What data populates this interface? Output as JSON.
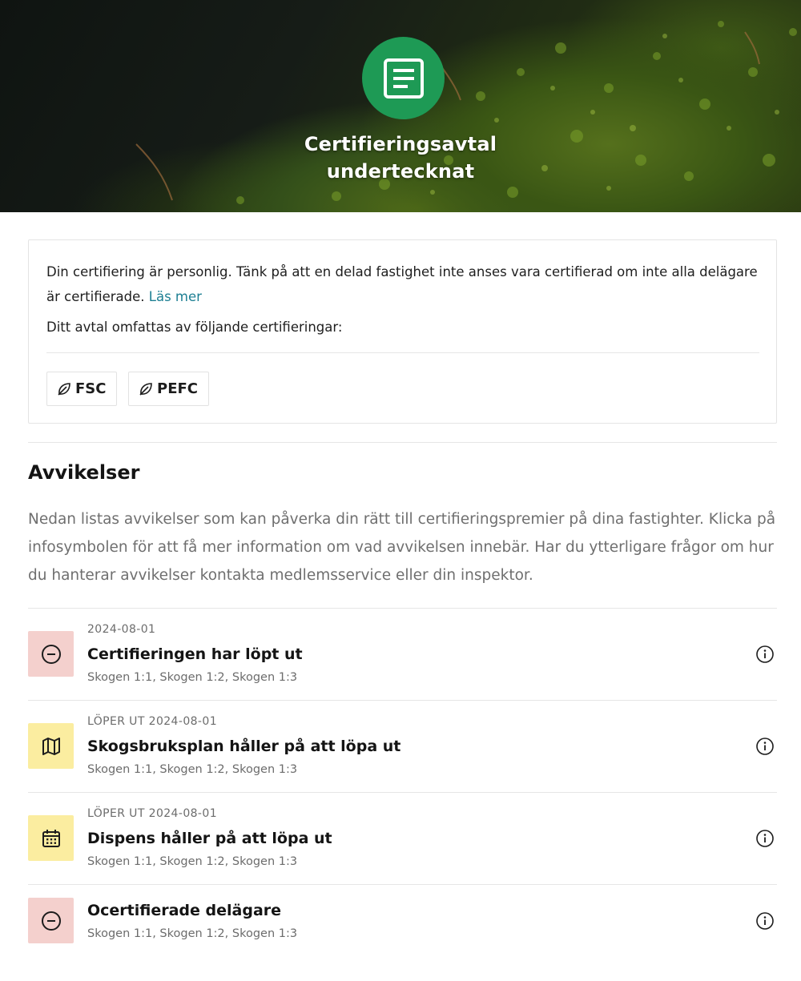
{
  "hero": {
    "title_line1": "Certifieringsavtal",
    "title_line2": "undertecknat",
    "icon": "document-icon",
    "icon_color": "#1e9a55"
  },
  "info": {
    "text": "Din certifiering är personlig. Tänk på att en delad fastighet inte anses vara certifierad om inte alla delägare är certifierade.",
    "link_label": "Läs mer",
    "link_color": "#1d7f93",
    "covered_label": "Ditt avtal omfattas av följande certifieringar:",
    "certifications": [
      {
        "label": "FSC",
        "icon": "leaf-icon"
      },
      {
        "label": "PEFC",
        "icon": "leaf-icon"
      }
    ]
  },
  "deviations": {
    "title": "Avvikelser",
    "description": "Nedan listas avvikelser som kan påverka din rätt till certifieringspremier på dina fastighter. Klicka på infosymbolen för att få mer information om vad avvikelsen innebär. Har du ytterligare frågor om hur du hanterar avvikelser kontakta medlemsservice eller din inspektor.",
    "items": [
      {
        "date": "2024-08-01",
        "title": "Certifieringen har löpt ut",
        "properties": "Skogen 1:1, Skogen 1:2, Skogen 1:3",
        "icon": "minus-circle-icon",
        "status_color": "#f4d0cd"
      },
      {
        "date": "LÖPER UT 2024-08-01",
        "title": "Skogsbruksplan håller på att löpa ut",
        "properties": "Skogen 1:1, Skogen 1:2, Skogen 1:3",
        "icon": "map-icon",
        "status_color": "#fbeda0"
      },
      {
        "date": "LÖPER UT 2024-08-01",
        "title": "Dispens håller på att löpa ut",
        "properties": "Skogen 1:1, Skogen 1:2, Skogen 1:3",
        "icon": "calendar-icon",
        "status_color": "#fbeda0"
      },
      {
        "date": "",
        "title": "Ocertifierade delägare",
        "properties": "Skogen 1:1, Skogen 1:2, Skogen 1:3",
        "icon": "minus-circle-icon",
        "status_color": "#f4d0cd"
      }
    ]
  }
}
